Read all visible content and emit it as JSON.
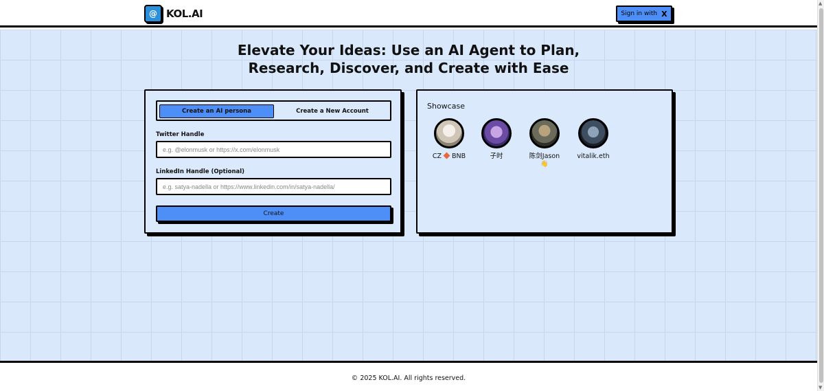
{
  "header": {
    "logo_symbol": "@",
    "logo_text": "KOL.AI",
    "signin_label": "Sign in with",
    "signin_icon": "X"
  },
  "main": {
    "headline_line1": "Elevate Your Ideas: Use an AI Agent to Plan,",
    "headline_line2": "Research, Discover, and Create with Ease"
  },
  "form": {
    "tabs": [
      {
        "label": "Create an AI persona",
        "active": true
      },
      {
        "label": "Create a New Account",
        "active": false
      }
    ],
    "twitter_label": "Twitter Handle",
    "twitter_placeholder": "e.g. @elonmusk or https://x.com/elonmusk",
    "linkedin_label": "LinkedIn Handle (Optional)",
    "linkedin_placeholder": "e.g. satya-nadella or https://www.linkedin.com/in/satya-nadella/",
    "create_label": "Create"
  },
  "showcase": {
    "title": "Showcase",
    "people": [
      {
        "name_left": "CZ",
        "name_right": "BNB"
      },
      {
        "name": "子时"
      },
      {
        "name": "陈剑Jason",
        "emoji": "👋"
      },
      {
        "name": "vitalik.eth"
      }
    ]
  },
  "footer": {
    "text": "© 2025 KOL.AI. All rights reserved."
  },
  "colors": {
    "accent": "#4e8ef7",
    "background": "#d9e8fb",
    "border": "#000000"
  }
}
